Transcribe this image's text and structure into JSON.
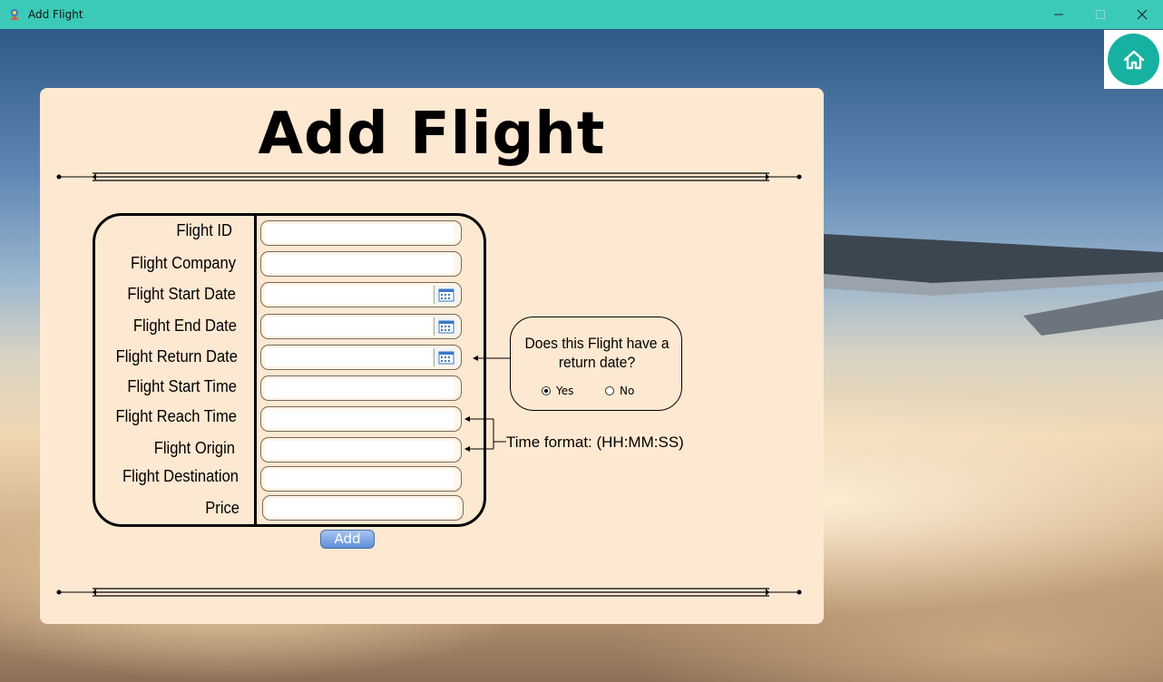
{
  "window": {
    "title": "Add Flight",
    "controls": [
      "minimize",
      "maximize",
      "close"
    ]
  },
  "home": {
    "icon": "home-icon"
  },
  "form": {
    "heading": "Add Flight",
    "fields": [
      {
        "label": "Flight ID",
        "type": "text",
        "value": ""
      },
      {
        "label": "Flight Company",
        "type": "text",
        "value": ""
      },
      {
        "label": "Flight Start Date",
        "type": "date",
        "value": ""
      },
      {
        "label": "Flight End Date",
        "type": "date",
        "value": ""
      },
      {
        "label": "Flight Return Date",
        "type": "date",
        "value": ""
      },
      {
        "label": "Flight Start Time",
        "type": "text",
        "value": ""
      },
      {
        "label": "Flight Reach Time",
        "type": "text",
        "value": ""
      },
      {
        "label": "Flight Origin",
        "type": "text",
        "value": ""
      },
      {
        "label": "Flight Destination",
        "type": "text",
        "value": ""
      },
      {
        "label": "Price",
        "type": "text",
        "value": ""
      }
    ],
    "add_label": "Add",
    "return_question": "Does this Flight have a return date?",
    "return_options": [
      "Yes",
      "No"
    ],
    "return_selected": "Yes",
    "time_format_note": "Time format: (HH:MM:SS)"
  },
  "colors": {
    "titlebar": "#3bcab7",
    "panel": "#fde8d1",
    "home_button": "#17b1a1"
  }
}
